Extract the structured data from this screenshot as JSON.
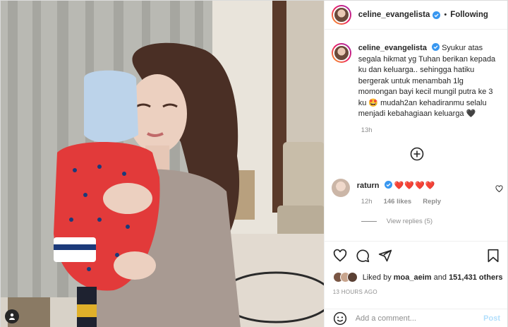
{
  "header": {
    "username": "celine_evangelista",
    "separator": "•",
    "follow_status": "Following"
  },
  "caption": {
    "username": "celine_evangelista",
    "text": "Syukur atas segala hikmat yg Tuhan berikan kepada ku dan keluarga.. sehingga hatiku bergerak untuk menambah 1lg momongan bayi kecil mungil putra ke 3 ku 🤩 mudah2an kehadiranmu selalu menjadi kebahagiaan keluarga 🖤",
    "time": "13h"
  },
  "comment": {
    "username": "raturn",
    "text": "❤️❤️❤️❤️",
    "time": "12h",
    "likes": "146 likes",
    "reply_label": "Reply"
  },
  "view_replies": "View replies (5)",
  "likes": {
    "prefix": "Liked by",
    "user": "moa_aeim",
    "conjunction": "and",
    "others": "151,431 others"
  },
  "timestamp": "13 HOURS AGO",
  "add_comment": {
    "placeholder": "Add a comment...",
    "post_label": "Post"
  },
  "colors": {
    "verified": "#3897f0",
    "heart": "#ed1c24",
    "post_disabled": "#b2dffc",
    "muted": "#8e8e8e"
  },
  "icons": [
    "verified-badge-icon",
    "add-circle-icon",
    "heart-outline-icon",
    "comment-icon",
    "share-icon",
    "bookmark-icon",
    "emoji-icon",
    "tag-user-icon"
  ]
}
